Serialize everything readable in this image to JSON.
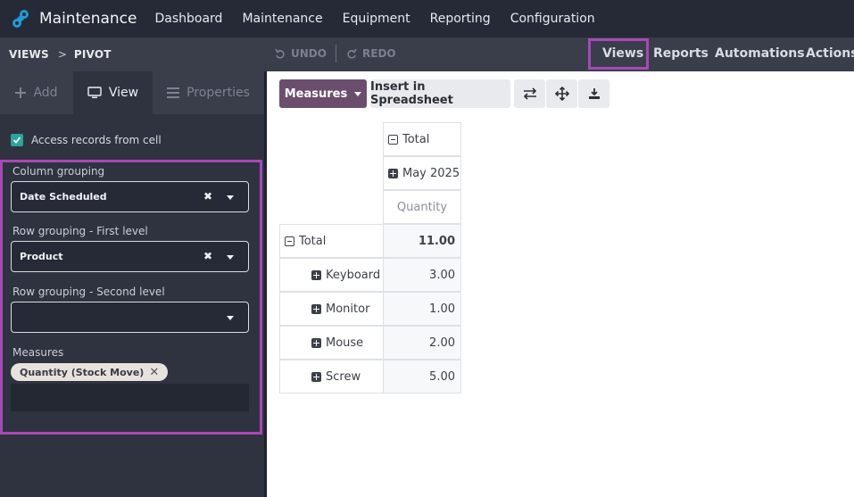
{
  "topbar": {
    "app_name": "Maintenance",
    "menu": [
      "Dashboard",
      "Maintenance",
      "Equipment",
      "Reporting",
      "Configuration"
    ]
  },
  "subbar": {
    "breadcrumb": [
      "VIEWS",
      "PIVOT"
    ],
    "breadcrumb_separator": ">",
    "undo_label": "UNDO",
    "redo_label": "REDO",
    "tabs": [
      "Views",
      "Reports",
      "Automations",
      "Actions"
    ],
    "active_tab": "Views"
  },
  "left_panel": {
    "tabs": [
      {
        "label": "Add",
        "icon": "plus-icon"
      },
      {
        "label": "View",
        "icon": "monitor-icon"
      },
      {
        "label": "Properties",
        "icon": "list-icon"
      }
    ],
    "active_tab": "View",
    "access_records_label": "Access records from cell",
    "access_records_checked": true,
    "column_grouping": {
      "label": "Column grouping",
      "value": "Date Scheduled"
    },
    "row_first": {
      "label": "Row grouping - First level",
      "value": "Product"
    },
    "row_second": {
      "label": "Row grouping - Second level",
      "value": ""
    },
    "measures": {
      "label": "Measures",
      "tags": [
        "Quantity (Stock Move)"
      ]
    }
  },
  "toolbar": {
    "measures_label": "Measures",
    "insert_label": "Insert in Spreadsheet",
    "icons": [
      "flip-axis-icon",
      "expand-all-icon",
      "download-icon"
    ]
  },
  "pivot": {
    "col_total_label": "Total",
    "col_group_label": "May 2025",
    "measure_label": "Quantity",
    "row_total_label": "Total",
    "row_total_value": "11.00",
    "rows": [
      {
        "label": "Keyboard",
        "value": "3.00"
      },
      {
        "label": "Monitor",
        "value": "1.00"
      },
      {
        "label": "Mouse",
        "value": "2.00"
      },
      {
        "label": "Screw",
        "value": "5.00"
      }
    ]
  },
  "colors": {
    "accent_highlight": "#a649b8",
    "primary_button": "#6b4e6e",
    "checkbox": "#2aa59b"
  }
}
